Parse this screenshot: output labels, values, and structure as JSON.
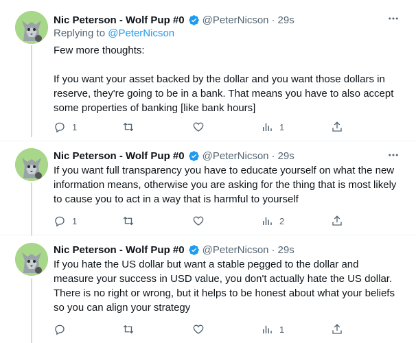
{
  "colors": {
    "accent": "#1d9bf0",
    "muted": "#536471",
    "text": "#0f1419",
    "verified": "#1d9bf0"
  },
  "tweets": [
    {
      "author_name": "Nic Peterson - Wolf Pup #0",
      "handle": "@PeterNicson",
      "separator": "·",
      "time": "29s",
      "replying_prefix": "Replying to ",
      "replying_to": "@PeterNicson",
      "text": "Few more thoughts:\n\nIf you want your asset backed by the dollar and you want those dollars in reserve, they're going to be in a bank. That means you have to also accept some properties of banking [like bank hours]",
      "replies": "1",
      "retweets": "",
      "likes": "",
      "views": "1"
    },
    {
      "author_name": "Nic Peterson - Wolf Pup #0",
      "handle": "@PeterNicson",
      "separator": "·",
      "time": "29s",
      "text": "If you want full transparency you have to educate yourself on what the new information means, otherwise you are asking for the thing that is most likely to cause you to act in a way that is harmful to yourself",
      "replies": "1",
      "retweets": "",
      "likes": "",
      "views": "2"
    },
    {
      "author_name": "Nic Peterson - Wolf Pup #0",
      "handle": "@PeterNicson",
      "separator": "·",
      "time": "29s",
      "text": "If you hate the US dollar but want a stable pegged to the dollar and measure your success in USD value, you don't actually hate the US dollar. There is no right or wrong, but it helps to be honest about what your beliefs so you can align your strategy",
      "replies": "",
      "retweets": "",
      "likes": "",
      "views": "1"
    }
  ],
  "icons": {
    "more": "more-horizontal-icon",
    "reply": "reply-icon",
    "retweet": "retweet-icon",
    "like": "heart-icon",
    "views": "views-chart-icon",
    "share": "share-icon",
    "verified": "verified-badge-icon"
  }
}
